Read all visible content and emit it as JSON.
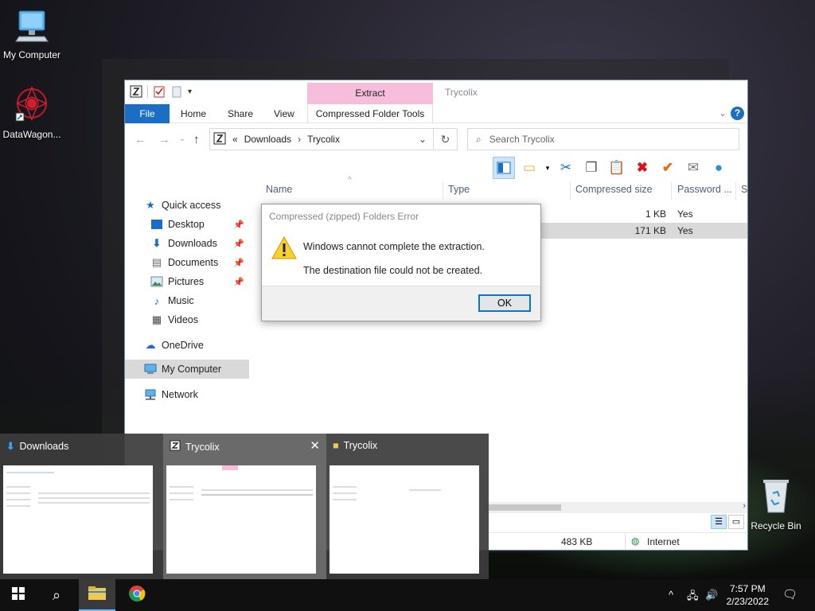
{
  "desktop": {
    "icons": [
      {
        "label": "My Computer"
      },
      {
        "label": "DataWagon..."
      },
      {
        "label": "Recycle Bin"
      }
    ]
  },
  "window": {
    "title": "Trycolix",
    "context_group": "Extract",
    "tabs": [
      "File",
      "Home",
      "Share",
      "View",
      "Compressed Folder Tools"
    ],
    "address": {
      "chevrons": "«",
      "path": [
        "Downloads",
        "Trycolix"
      ]
    },
    "search_placeholder": "Search Trycolix",
    "columns": [
      "Name",
      "Type",
      "Compressed size",
      "Password ...",
      "Si"
    ],
    "rows": [
      {
        "compressed_size": "1 KB",
        "password": "Yes"
      },
      {
        "compressed_size": "171 KB",
        "password": "Yes"
      }
    ],
    "nav": [
      {
        "label": "Quick access",
        "icon": "star-icon",
        "pinned": false
      },
      {
        "label": "Desktop",
        "icon": "desktop-folder-icon",
        "pinned": true
      },
      {
        "label": "Downloads",
        "icon": "download-arrow-icon",
        "pinned": true
      },
      {
        "label": "Documents",
        "icon": "documents-icon",
        "pinned": true
      },
      {
        "label": "Pictures",
        "icon": "pictures-icon",
        "pinned": true
      },
      {
        "label": "Music",
        "icon": "music-icon",
        "pinned": false
      },
      {
        "label": "Videos",
        "icon": "videos-icon",
        "pinned": false
      },
      {
        "label": "OneDrive",
        "icon": "cloud-icon",
        "pinned": false
      },
      {
        "label": "My Computer",
        "icon": "computer-icon",
        "pinned": false
      },
      {
        "label": "Network",
        "icon": "network-icon",
        "pinned": false
      }
    ],
    "status": {
      "size": "483 KB",
      "zone": "Internet"
    }
  },
  "dialog": {
    "title": "Compressed (zipped) Folders Error",
    "message1": "Windows cannot complete the extraction.",
    "message2": "The destination file could not be created.",
    "ok_label": "OK"
  },
  "thumbnails": [
    {
      "title": "Downloads",
      "icon": "download-arrow-icon"
    },
    {
      "title": "Trycolix",
      "icon": "zip-folder-icon",
      "close": "✕"
    },
    {
      "title": "Trycolix",
      "icon": "folder-icon"
    }
  ],
  "taskbar": {
    "time": "7:57 PM",
    "date": "2/23/2022"
  },
  "colors": {
    "accent": "#1a6fc4",
    "context_tab": "#f7bedb",
    "selection": "#d9d9d9"
  }
}
